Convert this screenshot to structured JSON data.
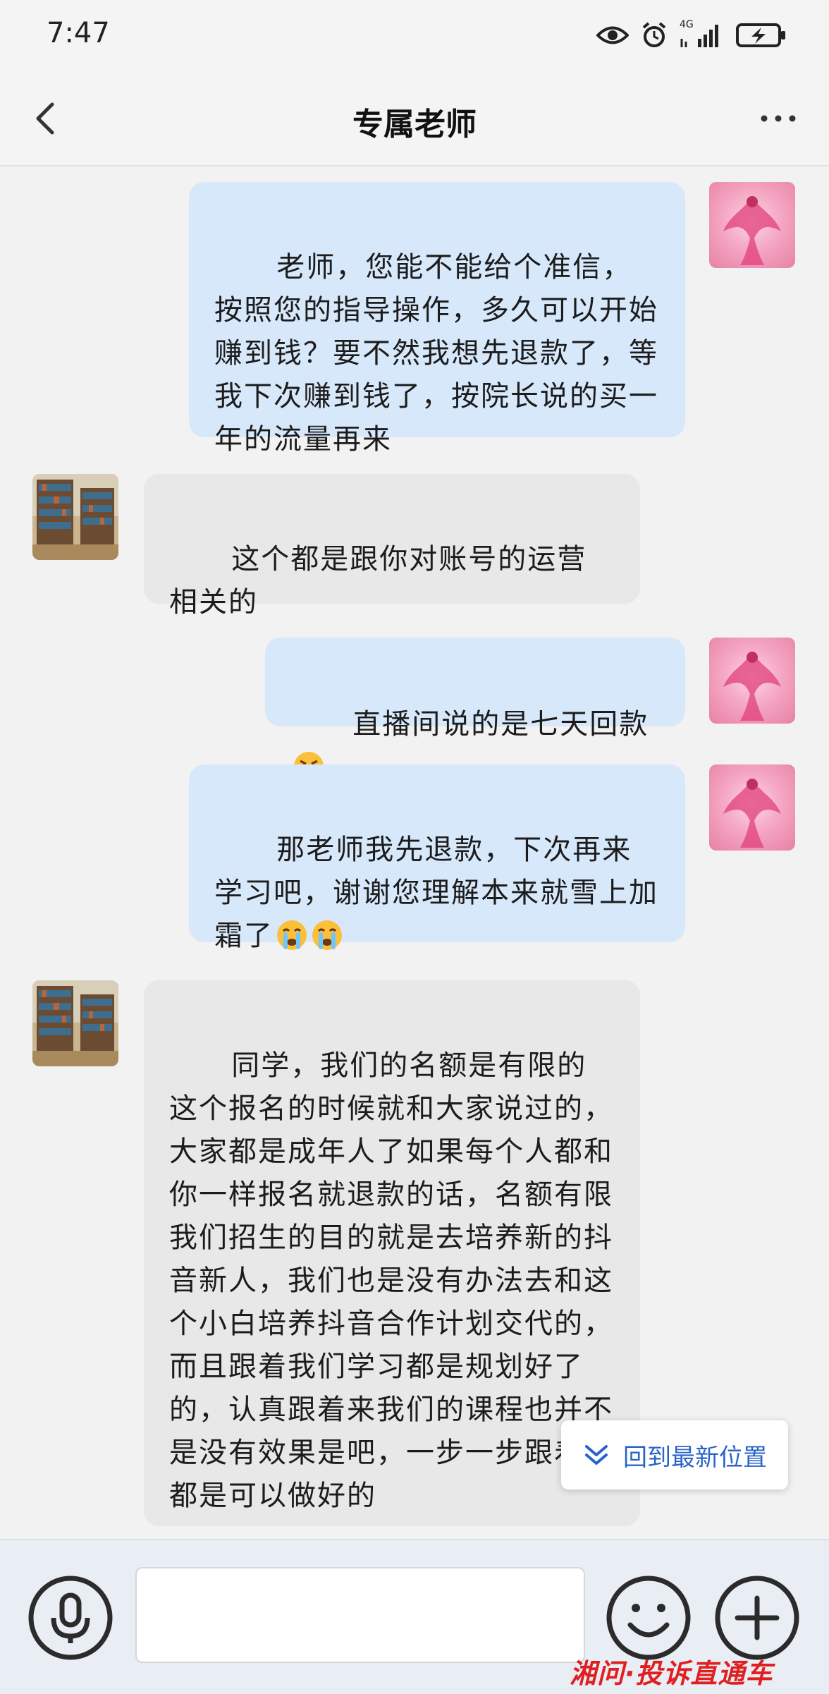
{
  "status_bar": {
    "time": "7:47",
    "network": "4G",
    "icons": [
      "eye-icon",
      "alarm-icon",
      "signal-icon",
      "battery-charging-icon"
    ]
  },
  "header": {
    "title": "专属老师",
    "back_icon": "chevron-left-icon",
    "more_icon": "more-horizontal-icon"
  },
  "messages": [
    {
      "sender": "me",
      "text": "老师，您能不能给个准信，按照您的指导操作，多久可以开始赚到钱？要不然我想先退款了，等我下次赚到钱了，按院长说的买一年的流量再来"
    },
    {
      "sender": "them",
      "text": "这个都是跟你对账号的运营相关的"
    },
    {
      "sender": "me",
      "text": "直播间说的是七天回款",
      "emoji": [
        "angry-face-emoji"
      ]
    },
    {
      "sender": "me",
      "text": "那老师我先退款，下次再来学习吧，谢谢您理解本来就雪上加霜了",
      "emoji": [
        "crying-face-emoji",
        "crying-face-emoji"
      ]
    },
    {
      "sender": "them",
      "text": "同学，我们的名额是有限的这个报名的时候就和大家说过的，大家都是成年人了如果每个人都和你一样报名就退款的话，名额有限我们招生的目的就是去培养新的抖音新人，我们也是没有办法去和这个小白培养抖音合作计划交代的，而且跟着我们学习都是规划好了的，认真跟着来我们的课程也并不是没有效果是吧，一步一步跟着来都是可以做好的"
    }
  ],
  "jump_to_latest": {
    "label": "回到最新位置",
    "icon": "double-chevron-down-icon"
  },
  "input_bar": {
    "voice_icon": "microphone-icon",
    "input_value": "",
    "emoji_icon": "smiley-icon",
    "plus_icon": "plus-icon"
  },
  "watermark": "湘问·投诉直通车",
  "colors": {
    "my_bubble": "#d8e8fb",
    "their_bubble": "#e8e8e8",
    "accent": "#2a63c8",
    "watermark": "#e02020"
  }
}
